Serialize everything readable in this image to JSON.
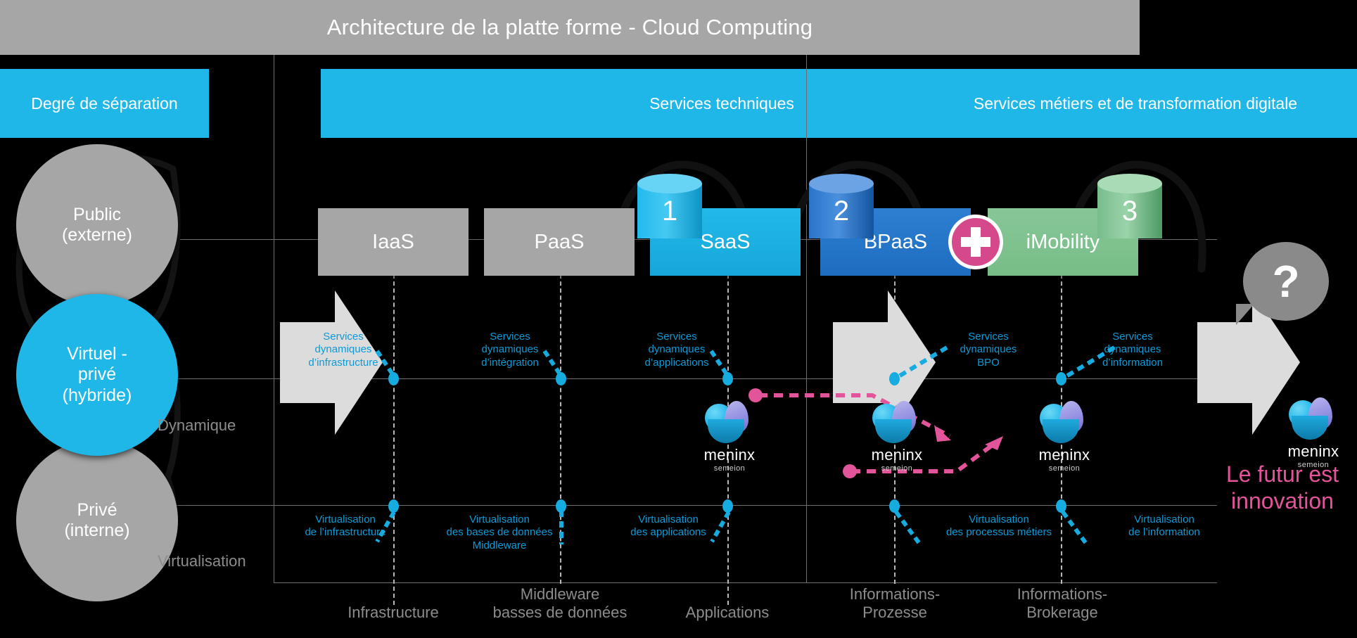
{
  "header": {
    "title": "Architecture de la platte forme - Cloud Computing"
  },
  "sections": {
    "separation": "Degré de séparation",
    "technical": "Services techniques",
    "business": "Services métiers et de transformation digitale"
  },
  "separation_levels": [
    {
      "id": "public",
      "label": "Public\n(externe)",
      "color": "#a6a6a6"
    },
    {
      "id": "virtual",
      "label": "Virtuel -\nprivé\n(hybride)",
      "color": "#1fb6e8"
    },
    {
      "id": "private",
      "label": "Privé\n(interne)",
      "color": "#a6a6a6"
    }
  ],
  "row_labels": {
    "dynamic": "Dynamique",
    "virtualisation": "Virtualisation"
  },
  "service_boxes": [
    {
      "id": "iaas",
      "label": "IaaS",
      "color": "#a6a6a6",
      "badge": null
    },
    {
      "id": "paas",
      "label": "PaaS",
      "color": "#a6a6a6",
      "badge": null
    },
    {
      "id": "saas",
      "label": "SaaS",
      "color": "#1fb6e8",
      "badge": "1"
    },
    {
      "id": "bpaas",
      "label": "BPaaS",
      "color": "#2e7fd1",
      "badge": "2"
    },
    {
      "id": "imobility",
      "label": "iMobility",
      "color": "#87c796",
      "badge": "3"
    }
  ],
  "plus_badge": {
    "symbol": "+",
    "color": "#d6488c"
  },
  "dynamic_services": [
    {
      "id": "infrastructure",
      "label": "Services\ndynamiques\nd’infrastructure"
    },
    {
      "id": "integration",
      "label": "Services\ndynamiques\nd’intégration"
    },
    {
      "id": "applications",
      "label": "Services\ndynamiques\nd’applications"
    },
    {
      "id": "bpo",
      "label": "Services\ndynamiques\nBPO"
    },
    {
      "id": "information",
      "label": "Services\ndynamiques\nd’information"
    }
  ],
  "virtualisation_services": [
    {
      "id": "infrastructure",
      "label": "Virtualisation\nde l’infrastructure"
    },
    {
      "id": "databases",
      "label": "Virtualisation\ndes bases de données\nMiddleware"
    },
    {
      "id": "applications",
      "label": "Virtualisation\ndes applications"
    },
    {
      "id": "business-process",
      "label": "Virtualisation\ndes processus métiers"
    },
    {
      "id": "information",
      "label": "Virtualisation\nde l’information"
    }
  ],
  "axis_labels": [
    {
      "id": "infrastructure",
      "label": "Infrastructure"
    },
    {
      "id": "middleware",
      "label": "Middleware\nbasses de données"
    },
    {
      "id": "applications",
      "label": "Applications"
    },
    {
      "id": "info-prozesse",
      "label": "Informations-\nProzesse"
    },
    {
      "id": "info-brokerage",
      "label": "Informations-\nBrokerage"
    }
  ],
  "brand": {
    "name": "meninx",
    "tagline": "semeion"
  },
  "callout": {
    "question_mark": "?",
    "future_text": "Le futur est\ninnovation"
  },
  "colors": {
    "accent_cyan": "#1fb6e8",
    "accent_blue": "#2e7fd1",
    "accent_green": "#87c796",
    "accent_pink": "#e2559b",
    "grey": "#a6a6a6",
    "background": "#000000"
  }
}
